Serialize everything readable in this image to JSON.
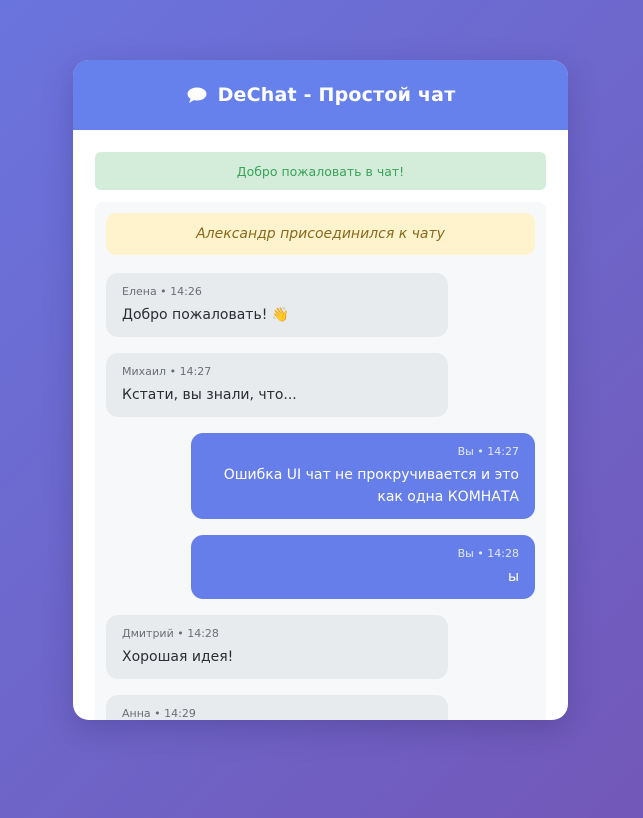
{
  "header": {
    "title": "DeChat - Простой чат",
    "icon": "speech-bubble-icon"
  },
  "welcome_text": "Добро пожаловать в чат!",
  "system_message": "Александр присоединился к чату",
  "messages": [
    {
      "author": "Елена",
      "time": "14:26",
      "text": "Добро пожаловать! 👋",
      "mine": false
    },
    {
      "author": "Михаил",
      "time": "14:27",
      "text": "Кстати, вы знали, что...",
      "mine": false
    },
    {
      "author": "Вы",
      "time": "14:27",
      "text": "Ошибка UI чат не прокручивается и это как одна КОМНАТА",
      "mine": true
    },
    {
      "author": "Вы",
      "time": "14:28",
      "text": "ы",
      "mine": true
    },
    {
      "author": "Дмитрий",
      "time": "14:28",
      "text": "Хорошая идея!",
      "mine": false
    },
    {
      "author": "Анна",
      "time": "14:29",
      "text": "",
      "mine": false
    }
  ],
  "colors": {
    "header": "#6680ec",
    "mine_bubble": "#667eea",
    "other_bubble": "#e8ebee",
    "welcome_bg": "#d4edda",
    "system_bg": "#fff3cd"
  }
}
